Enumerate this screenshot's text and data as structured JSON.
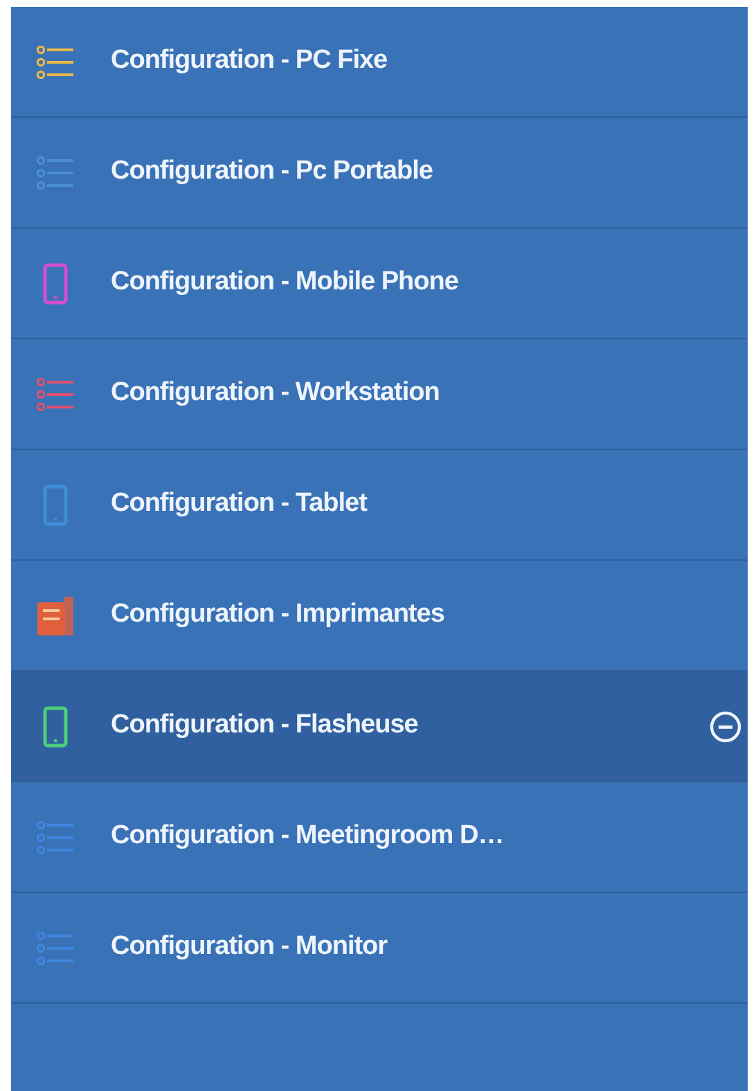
{
  "menu": {
    "items": [
      {
        "label": "Configuration - PC Fixe",
        "kind": "list",
        "color": "#e8b84a",
        "selected": false
      },
      {
        "label": "Configuration - Pc Portable",
        "kind": "list",
        "color": "#4a8fd0",
        "selected": false
      },
      {
        "label": "Configuration - Mobile Phone",
        "kind": "phone",
        "color": "#d44fd0",
        "selected": false
      },
      {
        "label": "Configuration - Workstation",
        "kind": "list",
        "color": "#e0506e",
        "selected": false
      },
      {
        "label": "Configuration - Tablet",
        "kind": "phone",
        "color": "#3f8fd6",
        "selected": false
      },
      {
        "label": "Configuration - Imprimantes",
        "kind": "printer",
        "color": "#e0603e",
        "selected": false
      },
      {
        "label": "Configuration - Flasheuse",
        "kind": "phone",
        "color": "#4ccf7a",
        "selected": true
      },
      {
        "label": "Configuration - Meetingroom D…",
        "kind": "list",
        "color": "#3f86de",
        "selected": false
      },
      {
        "label": "Configuration - Monitor",
        "kind": "list",
        "color": "#3f86de",
        "selected": false
      }
    ]
  }
}
